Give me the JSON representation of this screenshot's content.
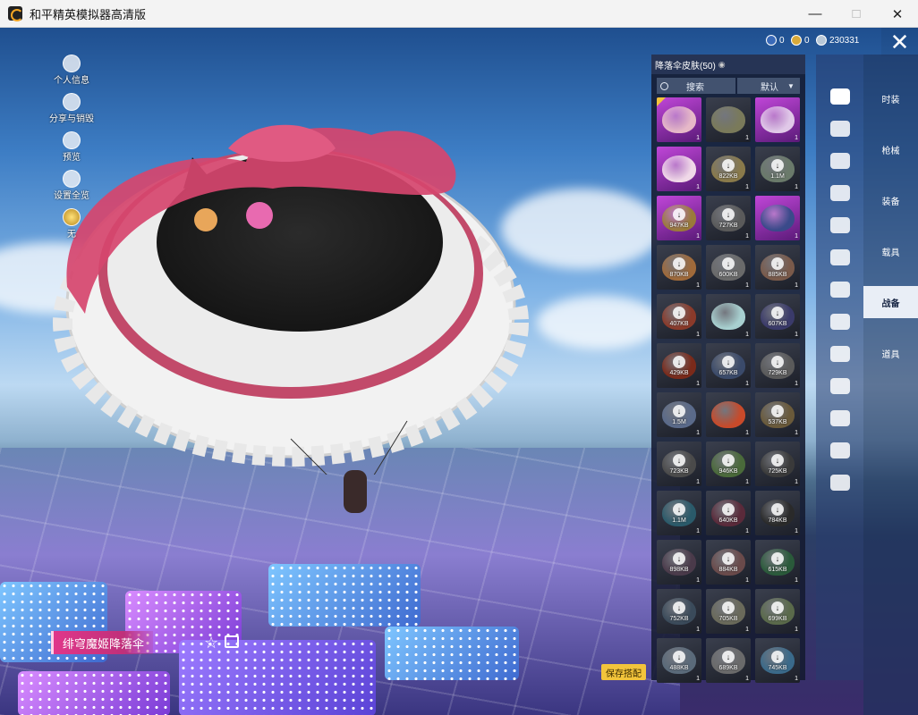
{
  "window": {
    "title": "和平精英模拟器高清版",
    "controls": [
      "minimize",
      "maximize",
      "close"
    ]
  },
  "top_bar": {
    "currencies": [
      {
        "icon": "coin-blue-icon",
        "value": "0"
      },
      {
        "icon": "coin-gold-icon",
        "value": "0"
      },
      {
        "icon": "coin-silver-icon",
        "value": "230331"
      }
    ]
  },
  "left_tools": [
    {
      "icon": "avatar-icon",
      "label": "个人信息"
    },
    {
      "icon": "share-icon",
      "label": "分享与销毁"
    },
    {
      "icon": "eye-icon",
      "label": "预览"
    },
    {
      "icon": "setting-icon",
      "label": "设置全览"
    },
    {
      "icon": "medal-icon",
      "label": "无"
    }
  ],
  "skin_name": "绯穹魔姬降落伞",
  "save_button": "保存搭配",
  "panel": {
    "title": "降落伞皮肤(50)",
    "search_placeholder": "搜索",
    "sort_label": "默认",
    "items": [
      {
        "size": "",
        "count": "1",
        "rarity": "purple",
        "color": "#e6b8c8",
        "downloaded": true,
        "selected": true
      },
      {
        "size": "",
        "count": "1",
        "rarity": "dark",
        "color": "#7a7a5a",
        "downloaded": true
      },
      {
        "size": "",
        "count": "1",
        "rarity": "purple",
        "color": "#e0c8e8",
        "downloaded": true
      },
      {
        "size": "",
        "count": "1",
        "rarity": "purple",
        "color": "#f0d8e8",
        "downloaded": true
      },
      {
        "size": "822KB",
        "count": "1",
        "rarity": "dark",
        "color": "#8a7a4a"
      },
      {
        "size": "1.1M",
        "count": "1",
        "rarity": "dark",
        "color": "#6a7a6a"
      },
      {
        "size": "947KB",
        "count": "1",
        "rarity": "purple",
        "color": "#9a7a3a"
      },
      {
        "size": "727KB",
        "count": "1",
        "rarity": "dark",
        "color": "#5a5a5a"
      },
      {
        "size": "",
        "count": "1",
        "rarity": "purple",
        "color": "#3a4a8a",
        "downloaded": true
      },
      {
        "size": "870KB",
        "count": "1",
        "rarity": "dark",
        "color": "#a06a3a"
      },
      {
        "size": "600KB",
        "count": "1",
        "rarity": "dark",
        "color": "#6a6a6a"
      },
      {
        "size": "885KB",
        "count": "1",
        "rarity": "dark",
        "color": "#7a5a4a"
      },
      {
        "size": "407KB",
        "count": "1",
        "rarity": "dark",
        "color": "#8a3a2a"
      },
      {
        "size": "",
        "count": "1",
        "rarity": "dark",
        "color": "#a8d0d0",
        "downloaded": true
      },
      {
        "size": "607KB",
        "count": "1",
        "rarity": "dark",
        "color": "#3a3a6a"
      },
      {
        "size": "429KB",
        "count": "1",
        "rarity": "dark",
        "color": "#7a2a1a"
      },
      {
        "size": "657KB",
        "count": "1",
        "rarity": "dark",
        "color": "#3a4a6a"
      },
      {
        "size": "729KB",
        "count": "1",
        "rarity": "dark",
        "color": "#5a5a5a"
      },
      {
        "size": "1.5M",
        "count": "1",
        "rarity": "dark",
        "color": "#5a6a8a"
      },
      {
        "size": "",
        "count": "1",
        "rarity": "dark",
        "color": "#c84a2a",
        "downloaded": true
      },
      {
        "size": "537KB",
        "count": "1",
        "rarity": "dark",
        "color": "#6a5a3a"
      },
      {
        "size": "723KB",
        "count": "1",
        "rarity": "dark",
        "color": "#4a4a4a"
      },
      {
        "size": "946KB",
        "count": "1",
        "rarity": "dark",
        "color": "#4a6a3a"
      },
      {
        "size": "725KB",
        "count": "1",
        "rarity": "dark",
        "color": "#3a3a3a"
      },
      {
        "size": "1.1M",
        "count": "1",
        "rarity": "dark",
        "color": "#2a5a6a"
      },
      {
        "size": "640KB",
        "count": "1",
        "rarity": "dark",
        "color": "#5a2a3a"
      },
      {
        "size": "784KB",
        "count": "1",
        "rarity": "dark",
        "color": "#2a2a2a"
      },
      {
        "size": "898KB",
        "count": "1",
        "rarity": "dark",
        "color": "#4a3a4a"
      },
      {
        "size": "884KB",
        "count": "1",
        "rarity": "dark",
        "color": "#6a4a4a"
      },
      {
        "size": "615KB",
        "count": "1",
        "rarity": "dark",
        "color": "#2a5a3a"
      },
      {
        "size": "752KB",
        "count": "1",
        "rarity": "dark",
        "color": "#3a4a5a"
      },
      {
        "size": "705KB",
        "count": "1",
        "rarity": "dark",
        "color": "#6a6a5a"
      },
      {
        "size": "699KB",
        "count": "1",
        "rarity": "dark",
        "color": "#5a6a4a"
      },
      {
        "size": "488KB",
        "count": "1",
        "rarity": "dark",
        "color": "#5a6a7a"
      },
      {
        "size": "689KB",
        "count": "1",
        "rarity": "dark",
        "color": "#6a6a6a"
      },
      {
        "size": "745KB",
        "count": "1",
        "rarity": "dark",
        "color": "#3a6a8a"
      }
    ]
  },
  "icon_rail": [
    "tshirt-icon",
    "boat-icon",
    "plane-icon",
    "jet-icon",
    "emote-icon",
    "robot-icon",
    "voice-icon",
    "sticker-icon",
    "image-icon",
    "spray-icon",
    "gesture-icon",
    "magic-icon",
    "parachute-icon"
  ],
  "categories": [
    {
      "label": "时装",
      "active": false
    },
    {
      "label": "枪械",
      "active": false
    },
    {
      "label": "装备",
      "active": false
    },
    {
      "label": "载具",
      "active": false
    },
    {
      "label": "战备",
      "active": true
    },
    {
      "label": "道具",
      "active": false
    }
  ],
  "colors": {
    "accent_pink": "#e0378a",
    "save_yellow": "#f2c43b",
    "panel_bg": "#141a30",
    "rarity_purple": "#c046d8"
  }
}
